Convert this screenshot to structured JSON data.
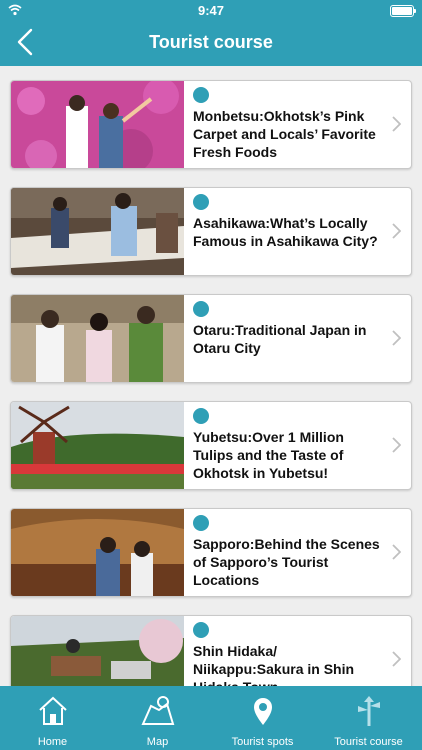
{
  "status": {
    "time": "9:47"
  },
  "header": {
    "title": "Tourist course",
    "back_icon": "chevron-left-icon"
  },
  "colors": {
    "accent": "#2f9fb6",
    "card_bg": "#ffffff",
    "page_bg": "#eeeeee"
  },
  "courses": [
    {
      "title": "Monbetsu:Okhotsk’s Pink Carpet and Locals’ Favorite Fresh Foods"
    },
    {
      "title": "Asahikawa:What’s Locally Famous in Asahikawa City?"
    },
    {
      "title": "Otaru:Traditional Japan in Otaru City"
    },
    {
      "title": "Yubetsu:Over 1 Million Tulips and the Taste of Okhotsk in Yubetsu!"
    },
    {
      "title": "Sapporo:Behind the Scenes of Sapporo’s Tourist Locations"
    },
    {
      "title": "Shin Hidaka/ Niikappu:Sakura in Shin Hidaka Town"
    }
  ],
  "tabs": [
    {
      "label": "Home",
      "icon": "home-icon"
    },
    {
      "label": "Map",
      "icon": "map-icon"
    },
    {
      "label": "Tourist spots",
      "icon": "location-pin-icon"
    },
    {
      "label": "Tourist course",
      "icon": "signpost-icon"
    }
  ]
}
